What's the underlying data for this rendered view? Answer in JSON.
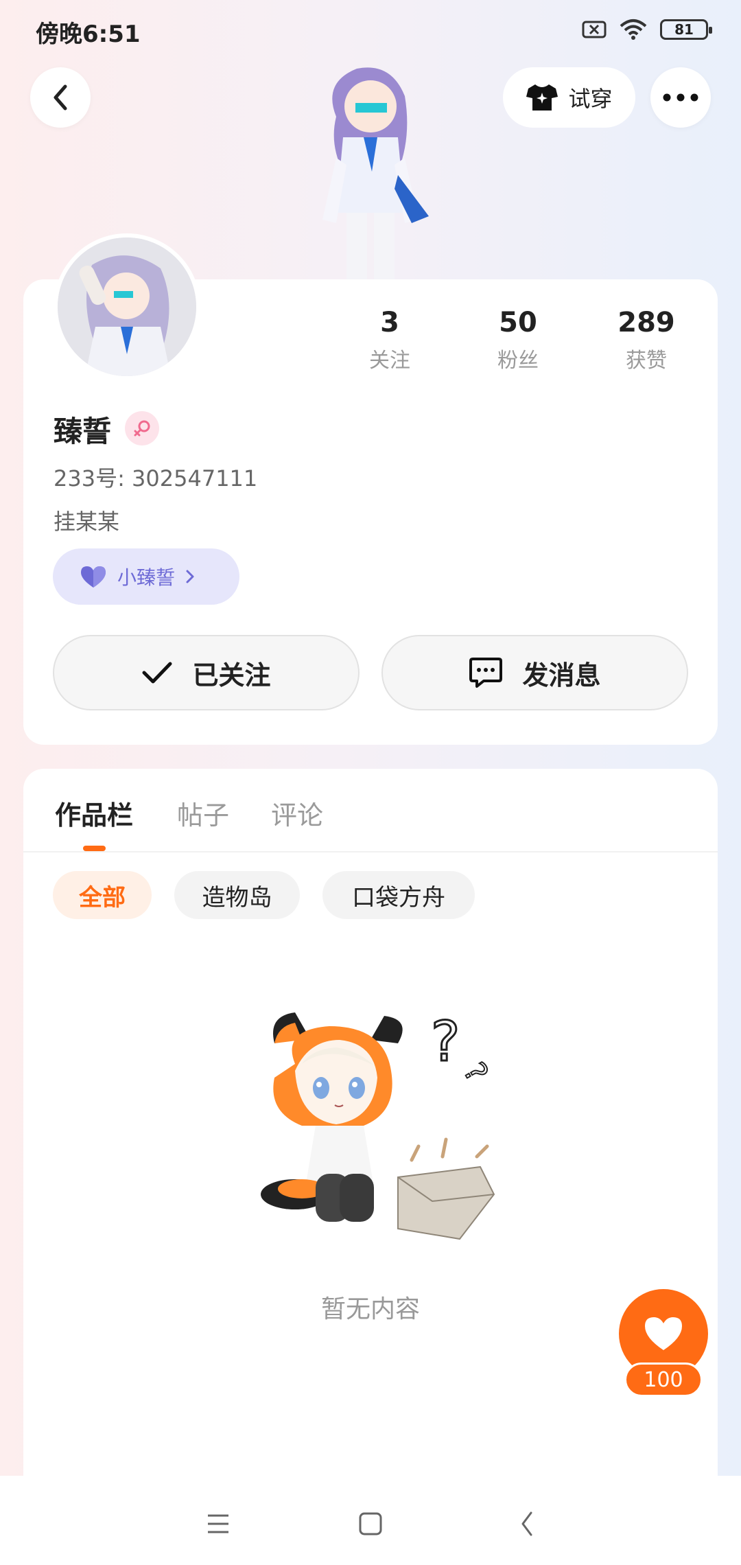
{
  "status_bar": {
    "time": "傍晚6:51",
    "battery": "81"
  },
  "header": {
    "try_on_label": "试穿"
  },
  "profile": {
    "name": "臻誓",
    "uid": "233号: 302547111",
    "bio": "挂某某",
    "fan_group_label": "小臻誓",
    "stats": [
      {
        "value": "3",
        "label": "关注"
      },
      {
        "value": "50",
        "label": "粉丝"
      },
      {
        "value": "289",
        "label": "获赞"
      }
    ],
    "follow_label": "已关注",
    "message_label": "发消息"
  },
  "tabs": [
    {
      "label": "作品栏",
      "active": true
    },
    {
      "label": "帖子",
      "active": false
    },
    {
      "label": "评论",
      "active": false
    }
  ],
  "filters": [
    {
      "label": "全部",
      "active": true
    },
    {
      "label": "造物岛",
      "active": false
    },
    {
      "label": "口袋方舟",
      "active": false
    }
  ],
  "empty_state": {
    "text": "暂无内容"
  },
  "like_fab": {
    "count": "100"
  },
  "colors": {
    "accent": "#ff6b14",
    "fan_pill_bg": "#e6e6fb",
    "fan_pill_text": "#6d6ad6"
  }
}
